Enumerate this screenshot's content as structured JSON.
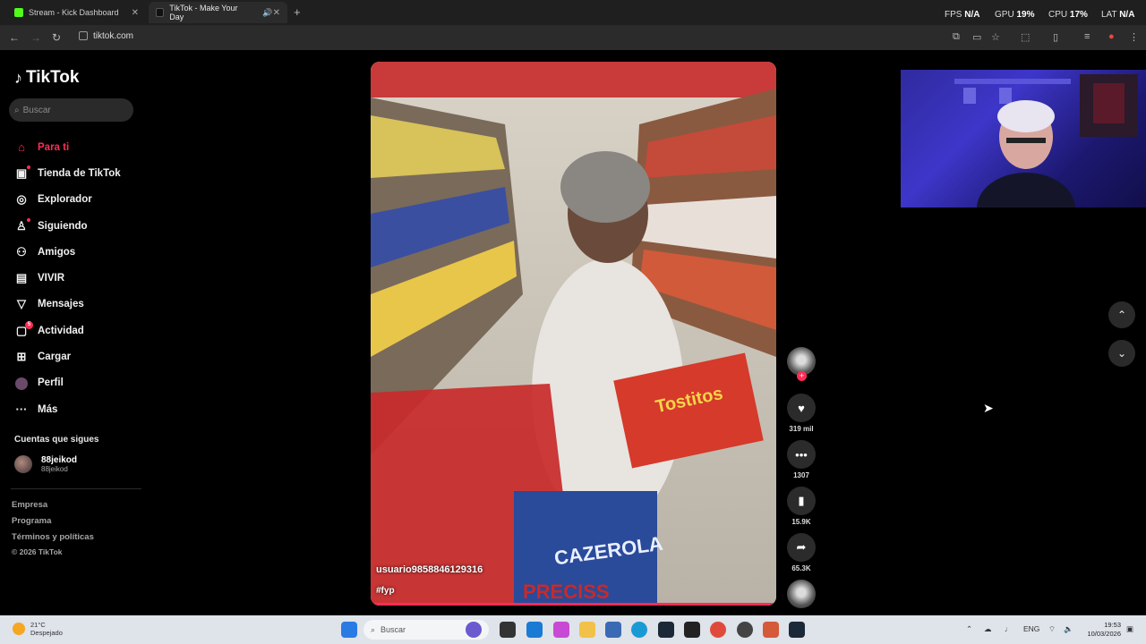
{
  "browser": {
    "tabs": [
      {
        "title": "Stream - Kick Dashboard",
        "close": "✕"
      },
      {
        "title": "TikTok - Make Your Day",
        "close": "✕"
      }
    ],
    "url": "tiktok.com"
  },
  "hud": {
    "fps_label": "FPS",
    "fps_value": "N/A",
    "gpu_label": "GPU",
    "gpu_value": "19%",
    "cpu_label": "CPU",
    "cpu_value": "17%",
    "lat_label": "LAT",
    "lat_value": "N/A"
  },
  "sidebar": {
    "logo": "TikTok",
    "search_placeholder": "Buscar",
    "items": [
      {
        "label": "Para ti",
        "icon": "home-icon"
      },
      {
        "label": "Tienda de TikTok",
        "icon": "shop-icon"
      },
      {
        "label": "Explorador",
        "icon": "compass-icon"
      },
      {
        "label": "Siguiendo",
        "icon": "following-icon"
      },
      {
        "label": "Amigos",
        "icon": "friends-icon"
      },
      {
        "label": "VIVIR",
        "icon": "live-icon"
      },
      {
        "label": "Mensajes",
        "icon": "send-icon"
      },
      {
        "label": "Actividad",
        "icon": "inbox-icon",
        "badge": "5"
      },
      {
        "label": "Cargar",
        "icon": "upload-icon"
      },
      {
        "label": "Perfil",
        "icon": "profile-avatar"
      },
      {
        "label": "Más",
        "icon": "more-icon"
      }
    ],
    "following_header": "Cuentas que sigues",
    "following": [
      {
        "name": "88jeikod",
        "handle": "88jeikod"
      }
    ],
    "footer": [
      "Empresa",
      "Programa",
      "Términos y políticas",
      "© 2026 TikTok"
    ]
  },
  "video": {
    "username": "usuario9858846129316",
    "caption": "#fyp",
    "scene_text_1": "Tostitos",
    "scene_text_2": "CAZEROLA",
    "scene_text_3": "PRECISS"
  },
  "actions": {
    "likes": "319 mil",
    "comments": "1307",
    "saves": "15.9K",
    "shares": "65.3K"
  },
  "taskbar": {
    "weather_temp": "21°C",
    "weather_desc": "Despejado",
    "search_placeholder": "Buscar",
    "lang": "ENG",
    "time": "19:53",
    "date": "10/03/2026"
  }
}
